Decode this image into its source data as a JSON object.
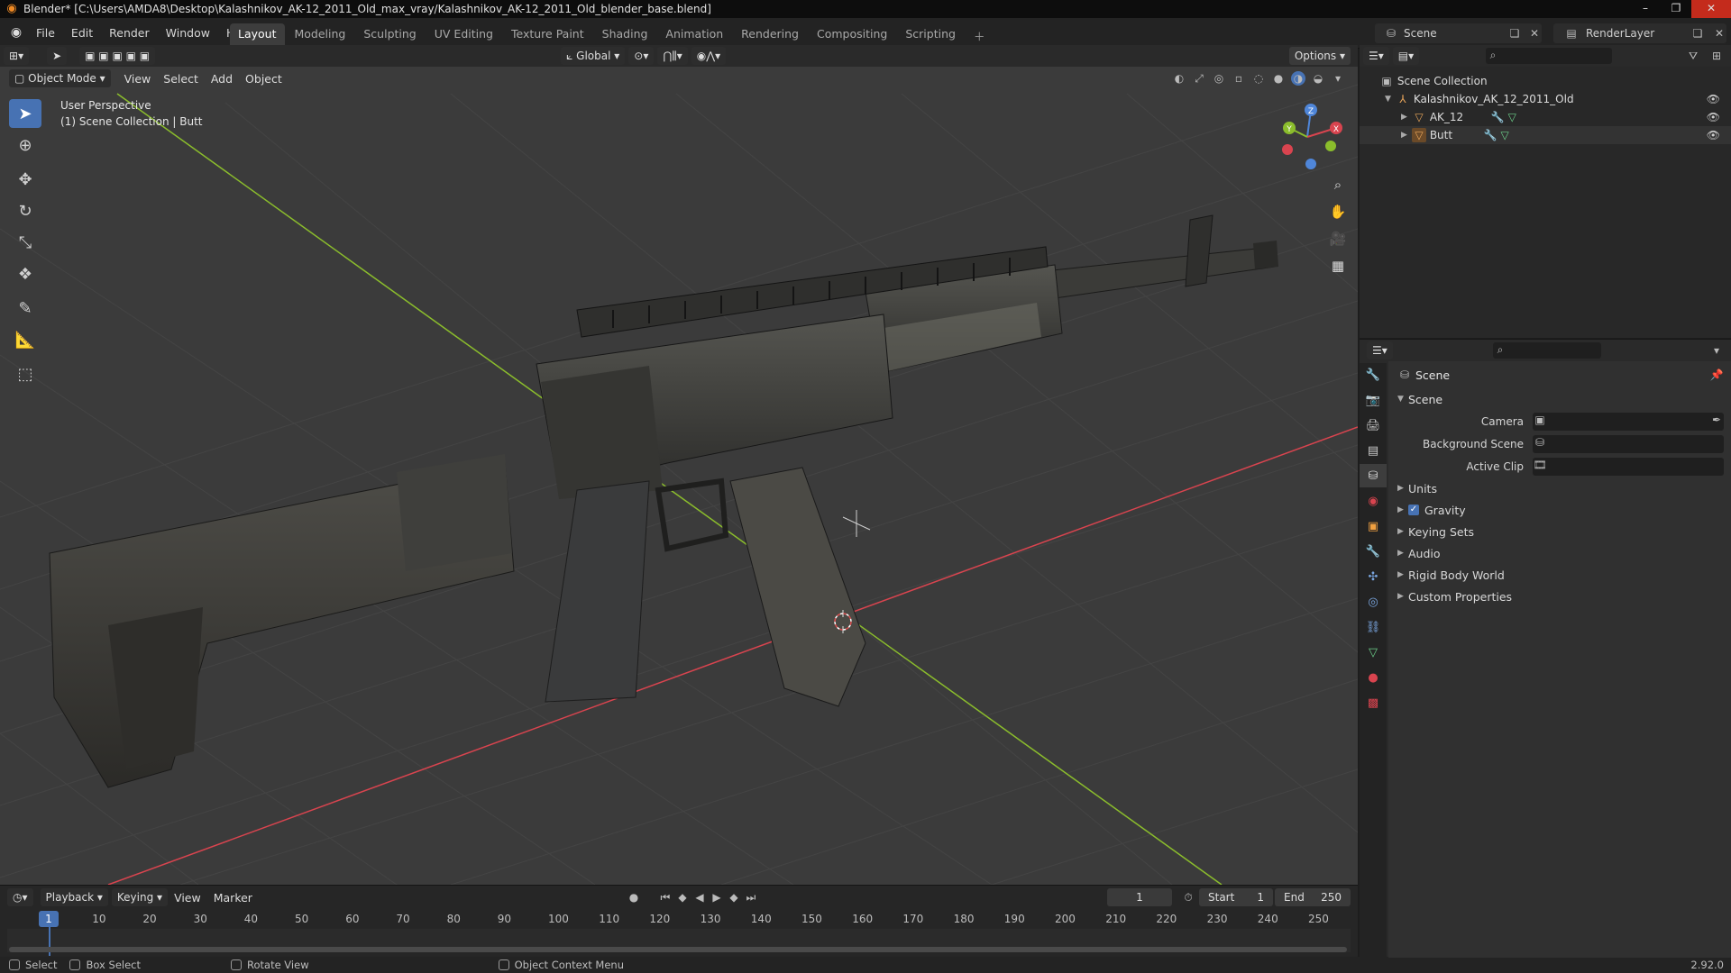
{
  "window": {
    "title": "Blender* [C:\\Users\\AMDA8\\Desktop\\Kalashnikov_AK-12_2011_Old_max_vray/Kalashnikov_AK-12_2011_Old_blender_base.blend]"
  },
  "menu": [
    "File",
    "Edit",
    "Render",
    "Window",
    "Help"
  ],
  "workspaces": [
    {
      "label": "Layout",
      "active": true
    },
    {
      "label": "Modeling"
    },
    {
      "label": "Sculpting"
    },
    {
      "label": "UV Editing"
    },
    {
      "label": "Texture Paint"
    },
    {
      "label": "Shading"
    },
    {
      "label": "Animation"
    },
    {
      "label": "Rendering"
    },
    {
      "label": "Compositing"
    },
    {
      "label": "Scripting"
    }
  ],
  "scene_selector": {
    "value": "Scene"
  },
  "renderlayer_selector": {
    "value": "RenderLayer"
  },
  "viewport_header": {
    "transform_orientation": "Global",
    "options_label": "Options",
    "mode": "Object Mode",
    "menus": [
      "View",
      "Select",
      "Add",
      "Object"
    ]
  },
  "viewport": {
    "perspective_label": "User Perspective",
    "collection_label": "(1) Scene Collection | Butt",
    "gizmo_axes": {
      "x": "X",
      "y": "Y",
      "z": "Z"
    }
  },
  "timeline": {
    "menus": [
      "Playback",
      "Keying",
      "View",
      "Marker"
    ],
    "current_frame": "1",
    "start_label": "Start",
    "start_value": "1",
    "end_label": "End",
    "end_value": "250",
    "ticks": [
      "10",
      "20",
      "30",
      "40",
      "50",
      "60",
      "70",
      "80",
      "90",
      "100",
      "110",
      "120",
      "130",
      "140",
      "150",
      "160",
      "170",
      "180",
      "190",
      "200",
      "210",
      "220",
      "230",
      "240",
      "250"
    ],
    "cursor_label": "1"
  },
  "statusbar": {
    "select": "Select",
    "box_select": "Box Select",
    "rotate_view": "Rotate View",
    "context_menu": "Object Context Menu",
    "version": "2.92.0"
  },
  "outliner": {
    "root": "Scene Collection",
    "collection": "Kalashnikov_AK_12_2011_Old",
    "objects": [
      "AK_12",
      "Butt"
    ]
  },
  "properties": {
    "title": "Scene",
    "panel": "Scene",
    "fields": [
      {
        "label": "Camera"
      },
      {
        "label": "Background Scene"
      },
      {
        "label": "Active Clip"
      }
    ],
    "subpanels": [
      "Units",
      "Gravity",
      "Keying Sets",
      "Audio",
      "Rigid Body World",
      "Custom Properties"
    ],
    "gravity_checked": true
  },
  "colors": {
    "accent": "#4772b3",
    "x_axis": "#d9444f",
    "y_axis": "#8bbd2c",
    "z_axis": "#4f86d9",
    "viewport_bg": "#3b3b3b"
  }
}
